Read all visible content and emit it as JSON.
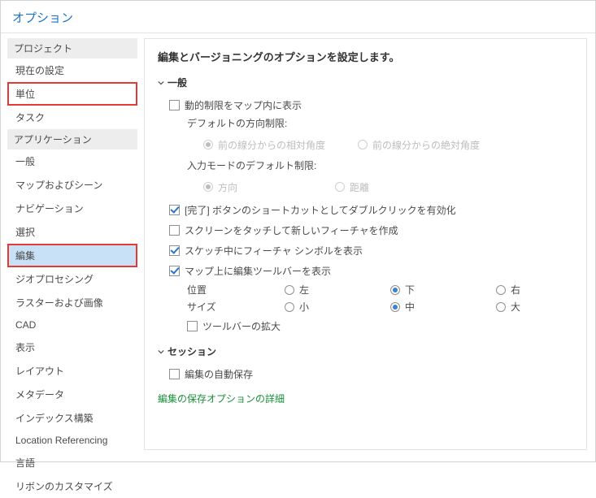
{
  "dialog_title": "オプション",
  "sidebar": {
    "group_project": "プロジェクト",
    "project_items": [
      "現在の設定",
      "単位",
      "タスク"
    ],
    "group_application": "アプリケーション",
    "app_items": [
      "一般",
      "マップおよびシーン",
      "ナビゲーション",
      "選択",
      "編集",
      "ジオプロセシング",
      "ラスターおよび画像",
      "CAD",
      "表示",
      "レイアウト",
      "メタデータ",
      "インデックス構築",
      "Location Referencing",
      "言語",
      "リボンのカスタマイズ"
    ]
  },
  "content": {
    "title": "編集とバージョニングのオプションを設定します。",
    "section_general": "一般",
    "dynamic_constraints": "動的制限をマップ内に表示",
    "default_direction": "デフォルトの方向制限:",
    "dir_relative": "前の線分からの相対角度",
    "dir_absolute": "前の線分からの絶対角度",
    "input_mode_default": "入力モードのデフォルト制限:",
    "inmode_direction": "方向",
    "inmode_distance": "距離",
    "dblclick_finish": "[完了] ボタンのショートカットとしてダブルクリックを有効化",
    "touch_create": "スクリーンをタッチして新しいフィーチャを作成",
    "sketch_symbols": "スケッチ中にフィーチャ シンボルを表示",
    "toolbar_show": "マップ上に編集ツールバーを表示",
    "toolbar_position": "位置",
    "pos_left": "左",
    "pos_bottom": "下",
    "pos_right": "右",
    "toolbar_size": "サイズ",
    "size_small": "小",
    "size_medium": "中",
    "size_large": "大",
    "toolbar_magnify": "ツールバーの拡大",
    "section_session": "セッション",
    "autosave": "編集の自動保存",
    "save_details_link": "編集の保存オプションの詳細"
  }
}
